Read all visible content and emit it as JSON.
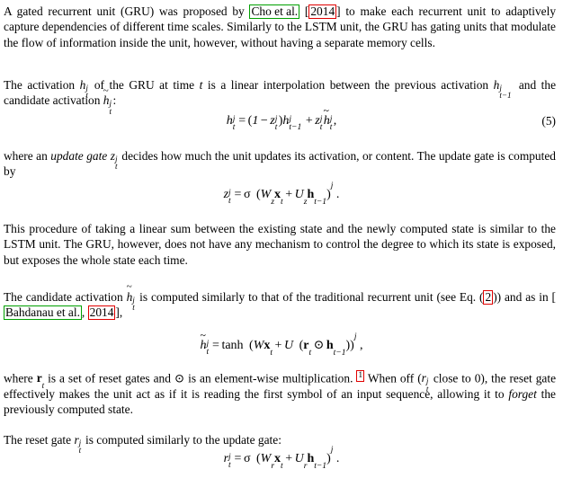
{
  "document": {
    "type": "academic-paper-excerpt",
    "topic": "Gated Recurrent Unit (GRU)",
    "colors": {
      "text": "#000000",
      "background": "#ffffff",
      "citation_link_box": "#00a000",
      "reference_link_box": "#e00000"
    }
  },
  "paragraphs": {
    "p1": {
      "seg1": "A gated recurrent unit (GRU) was proposed by ",
      "cite_author": "Cho et al.",
      "seg2": " [",
      "cite_year": "2014",
      "seg3": "] to make each recurrent unit to adaptively capture dependencies of different time scales. Similarly to the LSTM unit, the GRU has gating units that modulate the flow of information inside the unit, however, without having a separate memory cells."
    },
    "p2": {
      "seg1": "The activation ",
      "math1": "h_t^j",
      "seg2": " of the GRU at time ",
      "math2": "t",
      "seg3": " is a linear interpolation between the previous activation ",
      "math3": "h_{t-1}^j",
      "seg4": " and the candidate activation ",
      "math4": "h~_t^j",
      "seg5": ":"
    },
    "p3": {
      "seg1": "where an ",
      "emph": "update gate",
      "seg2": " ",
      "math1": "z_t^j",
      "seg3": " decides how much the unit updates its activation, or content. The update gate is computed by"
    },
    "p4": {
      "text": "This procedure of taking a linear sum between the existing state and the newly computed state is similar to the LSTM unit. The GRU, however, does not have any mechanism to control the degree to which its state is exposed, but exposes the whole state each time."
    },
    "p5": {
      "seg1": "The candidate activation ",
      "math1": "h~_t^j",
      "seg2": " is computed similarly to that of the traditional recurrent unit (see Eq. (",
      "eq_ref": "2",
      "seg3": ")) and as in [",
      "cite_author": "Bahdanau et al.",
      "seg4": ", ",
      "cite_year": "2014",
      "seg5": "],"
    },
    "p6": {
      "seg1": "where ",
      "math1": "r_t",
      "seg2": " is a set of reset gates and ",
      "math2": "⊙",
      "seg3": " is an element-wise multiplication. ",
      "footnote_mark": "1",
      "seg4": " When off (",
      "math3": "r_t^j",
      "seg5": " close to 0), the reset gate effectively makes the unit act as if it is reading the first symbol of an input sequence, allowing it to ",
      "emph": "forget",
      "seg6": " the previously computed state."
    },
    "p7": {
      "seg1": "The reset gate ",
      "math1": "r_t^j",
      "seg2": " is computed similarly to the update gate:"
    }
  },
  "equations": {
    "eq5": {
      "number": "(5)",
      "latex": "h_t^j = (1 - z_t^j) h_{t-1}^j + z_t^j \\tilde{h}_t^j ,",
      "parts": {
        "lhs_var": "h",
        "eq_sign": "=",
        "one": "1",
        "minus": "−",
        "z_var": "z",
        "plus": "+",
        "comma": ",",
        "paren_open": "(",
        "paren_close": ")"
      }
    },
    "eq6": {
      "latex": "z_t^j = \\sigma (W_z x_t + U_z h_{t-1})^j .",
      "parts": {
        "lhs_var": "z",
        "eq_sign": "=",
        "sigma": "σ",
        "W": "W",
        "x": "x",
        "plus": "+",
        "U": "U",
        "h": "h",
        "period": ".",
        "paren_open": "(",
        "paren_close": ")"
      }
    },
    "eq7": {
      "latex": "\\tilde{h}_t^j = \\tanh (W x_t + U (r_t \\odot h_{t-1}))^j ,",
      "parts": {
        "lhs_var": "h",
        "eq_sign": "=",
        "tanh": "tanh",
        "W": "W",
        "x": "x",
        "plus": "+",
        "U": "U",
        "r": "r",
        "odot": "⊙",
        "h": "h",
        "comma": ",",
        "paren_open": "(",
        "paren_close": ")"
      }
    },
    "eq8": {
      "latex": "r_t^j = \\sigma (W_r x_t + U_r h_{t-1})^j .",
      "parts": {
        "lhs_var": "r",
        "eq_sign": "=",
        "sigma": "σ",
        "W": "W",
        "x": "x",
        "plus": "+",
        "U": "U",
        "h": "h",
        "period": ".",
        "paren_open": "(",
        "paren_close": ")"
      }
    }
  },
  "scripts": {
    "sub_t": "t",
    "sub_t1": "t−1",
    "sup_j": "j",
    "sub_z": "z",
    "sub_r": "r"
  }
}
